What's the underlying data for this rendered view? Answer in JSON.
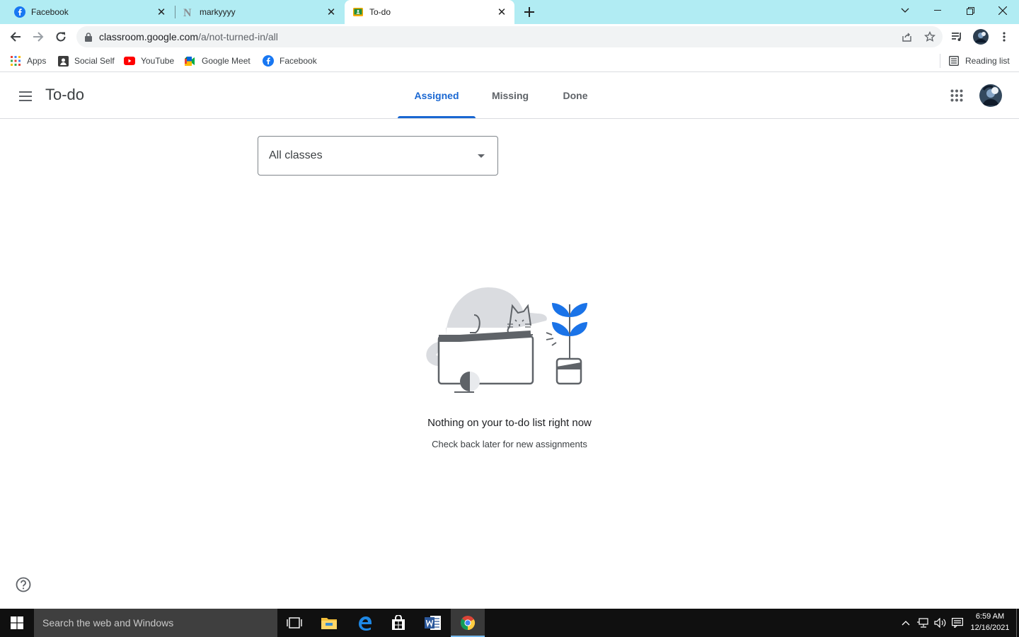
{
  "browser": {
    "tabs": [
      {
        "title": "Facebook",
        "icon": "facebook-icon",
        "active": false
      },
      {
        "title": "markyyyy",
        "icon": "notion-n-icon",
        "active": false
      },
      {
        "title": "To-do",
        "icon": "classroom-icon",
        "active": true
      }
    ],
    "url_host": "classroom.google.com",
    "url_path": "/a/not-turned-in/all",
    "bookmarks": [
      {
        "label": "Apps",
        "icon": "apps-grid-icon"
      },
      {
        "label": "Social Self",
        "icon": "social-self-icon"
      },
      {
        "label": "YouTube",
        "icon": "youtube-icon"
      },
      {
        "label": "Google Meet",
        "icon": "google-meet-icon"
      },
      {
        "label": "Facebook",
        "icon": "facebook-icon"
      }
    ],
    "reading_list": "Reading list"
  },
  "app": {
    "title": "To-do",
    "tabs": [
      {
        "label": "Assigned",
        "active": true
      },
      {
        "label": "Missing",
        "active": false
      },
      {
        "label": "Done",
        "active": false
      }
    ],
    "class_filter": "All classes",
    "empty_title": "Nothing on your to-do list right now",
    "empty_subtitle": "Check back later for new assignments",
    "accent_color": "#1967d2"
  },
  "taskbar": {
    "search_placeholder": "Search the web and Windows",
    "time": "6:59 AM",
    "date": "12/16/2021",
    "pinned": [
      "task-view-icon",
      "file-explorer-icon",
      "edge-icon",
      "store-icon",
      "word-icon",
      "chrome-icon"
    ]
  }
}
